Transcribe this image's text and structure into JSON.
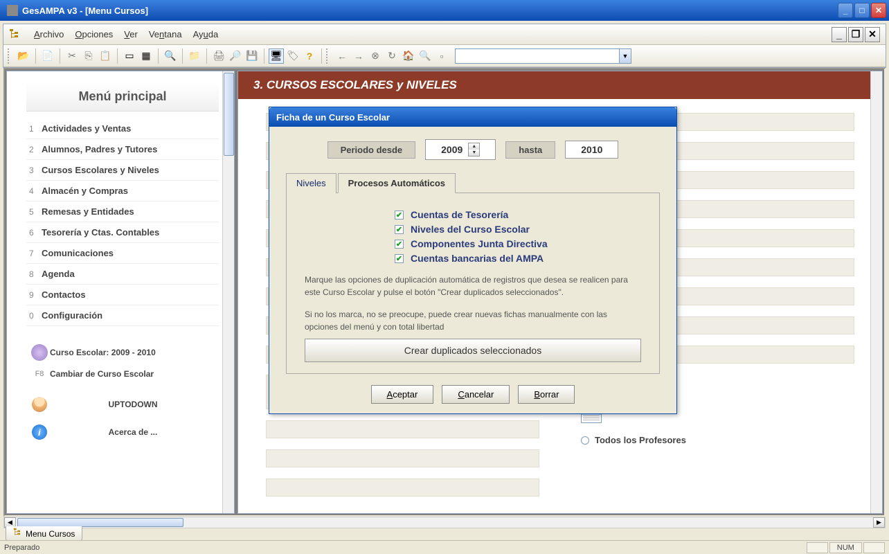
{
  "window": {
    "title": "GesAMPA v3 - [Menu Cursos]"
  },
  "menubar": {
    "items": [
      "Archivo",
      "Opciones",
      "Ver",
      "Ventana",
      "Ayuda"
    ]
  },
  "sidebar": {
    "title": "Menú principal",
    "items": [
      {
        "num": "1",
        "label": "Actividades y Ventas"
      },
      {
        "num": "2",
        "label": "Alumnos, Padres y Tutores"
      },
      {
        "num": "3",
        "label": "Cursos Escolares y Niveles"
      },
      {
        "num": "4",
        "label": "Almacén y Compras"
      },
      {
        "num": "5",
        "label": "Remesas y Entidades"
      },
      {
        "num": "6",
        "label": "Tesorería y Ctas. Contables"
      },
      {
        "num": "7",
        "label": "Comunicaciones"
      },
      {
        "num": "8",
        "label": "Agenda"
      },
      {
        "num": "9",
        "label": "Contactos"
      },
      {
        "num": "0",
        "label": "Configuración"
      }
    ],
    "curso_label": "Curso Escolar: 2009 - 2010",
    "cambiar_key": "F8",
    "cambiar_label": "Cambiar de Curso Escolar",
    "user_label": "UPTODOWN",
    "about_label": "Acerca de ..."
  },
  "main": {
    "header": "3.  CURSOS ESCOLARES y NIVELES",
    "radio_todos": "Todos los Profesores"
  },
  "dialog": {
    "title": "Ficha de un Curso Escolar",
    "periodo_desde_lbl": "Periodo desde",
    "periodo_desde_val": "2009",
    "periodo_hasta_lbl": "hasta",
    "periodo_hasta_val": "2010",
    "tabs": {
      "niveles": "Niveles",
      "procesos": "Procesos Automáticos"
    },
    "checks": [
      "Cuentas de Tesorería",
      "Niveles del Curso Escolar",
      "Componentes Junta Directiva",
      "Cuentas bancarias del AMPA"
    ],
    "help1": "Marque las opciones de duplicación automática de registros que desea se realicen para este Curso Escolar y pulse el botón \"Crear duplicados seleccionados\".",
    "help2": "Si no los marca, no se preocupe, puede crear nuevas fichas manualmente con las opciones del menú y con total libertad",
    "create_btn": "Crear duplicados seleccionados",
    "aceptar": "Aceptar",
    "cancelar": "Cancelar",
    "borrar": "Borrar"
  },
  "doctab": {
    "label": "Menu Cursos"
  },
  "status": {
    "ready": "Preparado",
    "num": "NUM"
  }
}
